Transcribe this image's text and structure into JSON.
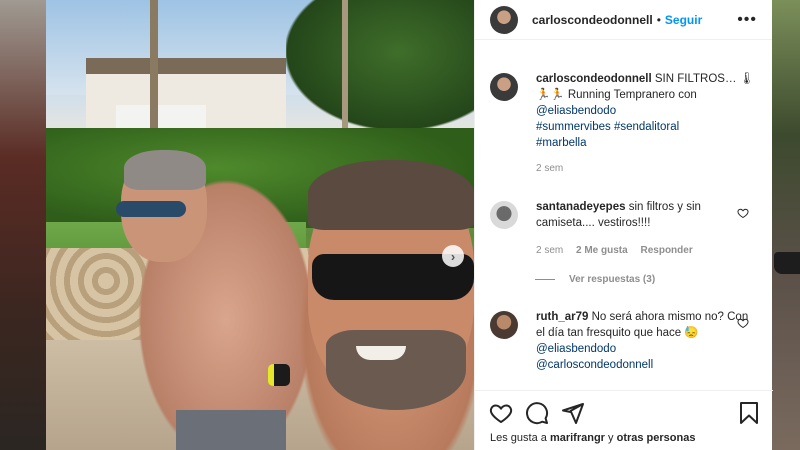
{
  "post": {
    "author": "carloscondeodonnell",
    "dot": "•",
    "follow_label": "Seguir",
    "more_label": "•••",
    "caption": {
      "author": "carloscondeodonnell",
      "text_1": "SIN FILTROS… 🌡",
      "text_2": "🏃🏃 Running Tempranero con",
      "mention": "@eliasbendodo",
      "hashtags_line1": "#summervibes #sendalitoral",
      "hashtags_line2": "#marbella",
      "time": "2 sem"
    },
    "comments": [
      {
        "user": "santanadeyepes",
        "text": "sin filtros y sin camiseta.... vestiros!!!!",
        "time": "2 sem",
        "likes": "2 Me gusta",
        "reply": "Responder",
        "view_replies": "Ver respuestas (3)"
      },
      {
        "user": "ruth_ar79",
        "text": "No será ahora mismo no? Con el día tan fresquito que hace 😓",
        "mention_1": "@eliasbendodo",
        "mention_2": "@carloscondeodonnell"
      }
    ],
    "likes_prefix": "Les gusta a",
    "likes_user": "marifrangr",
    "likes_connector": "y",
    "likes_others": "otras personas"
  },
  "icons": {
    "like": "heart-icon",
    "comment": "comment-icon",
    "share": "share-icon",
    "save": "bookmark-icon",
    "next": "chevron-right-icon"
  },
  "colors": {
    "accent": "#0095f6",
    "link": "#00376b",
    "muted": "#8e8e8e"
  }
}
